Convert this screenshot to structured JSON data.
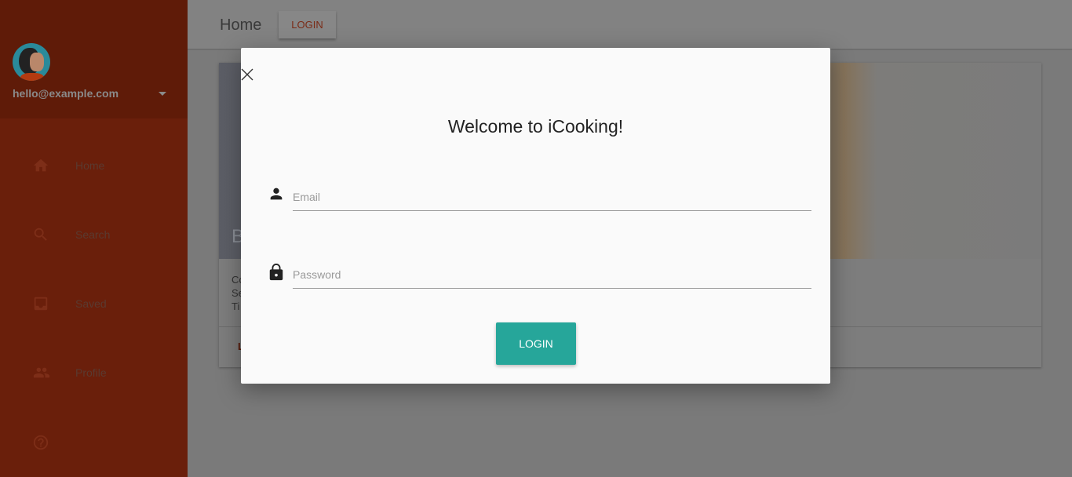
{
  "sidebar": {
    "email": "hello@example.com",
    "items": [
      {
        "label": "Home",
        "icon": "home-icon"
      },
      {
        "label": "Search",
        "icon": "search-icon"
      },
      {
        "label": "Saved",
        "icon": "inbox-icon"
      },
      {
        "label": "Profile",
        "icon": "people-icon"
      },
      {
        "label": "",
        "icon": "help-icon"
      }
    ]
  },
  "header": {
    "title": "Home",
    "login_label": "LOGIN"
  },
  "card": {
    "title": "B",
    "lines": [
      "Co",
      "Se",
      "Ti"
    ],
    "action": "L"
  },
  "modal": {
    "title": "Welcome to iCooking!",
    "email_placeholder": "Email",
    "password_placeholder": "Password",
    "login_label": "LOGIN",
    "button_color": "#26a69a"
  }
}
